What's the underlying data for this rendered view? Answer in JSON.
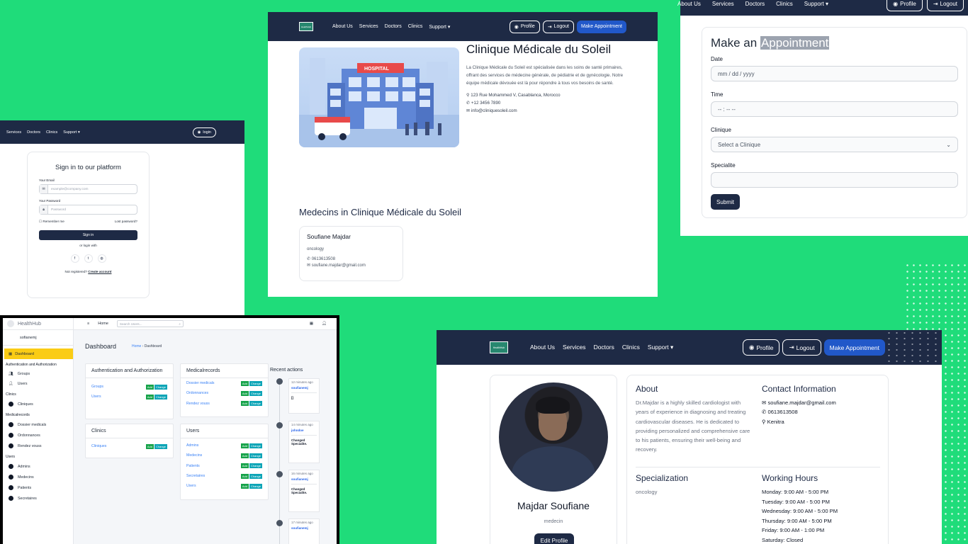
{
  "clinic_page": {
    "nav": {
      "logo": "HealthHub",
      "links": [
        "About Us",
        "Services",
        "Doctors",
        "Clinics",
        "Support ▾"
      ],
      "profile": "Profile",
      "logout": "Logout",
      "appointment": "Make Appointment"
    },
    "hospital_sign": "HOSPITAL",
    "title": "Clinique Médicale du Soleil",
    "description": "La Clinique Médicale du Soleil est spécialisée dans les soins de santé primaires, offrant des services de médecine générale, de pédiatrie et de gynécologie. Notre équipe médicale dévouée est là pour répondre à tous vos besoins de santé.",
    "address": "123 Rue Mohammed V, Casablanca, Morocco",
    "phone": "+12 3456 7890",
    "email": "info@cliniquesoleil.com",
    "medecins_title": "Medecins in Clinique Médicale du Soleil",
    "medecin": {
      "name": "Soufiane Majdar",
      "specialty": "oncology",
      "phone": "0613613508",
      "email": "soufiane.majdar@gmail.com"
    }
  },
  "appointment": {
    "nav": {
      "links": [
        "About Us",
        "Services",
        "Doctors",
        "Clinics",
        "Support ▾"
      ],
      "profile": "Profile",
      "logout": "Logout"
    },
    "title_a": "Make an ",
    "title_b": "Appointment",
    "date_label": "Date",
    "date_placeholder": "mm / dd / yyyy",
    "time_label": "Time",
    "time_placeholder": "-- : --  --",
    "clinique_label": "Clinique",
    "clinique_value": "Select a Clinique",
    "specialite_label": "Specialite",
    "specialite_value": "",
    "submit": "Submit"
  },
  "signin": {
    "nav": {
      "links": [
        "Services",
        "Doctors",
        "Clinics",
        "Support ▾"
      ],
      "login": "login"
    },
    "title": "Sign in to our platform",
    "email_label": "Your Email",
    "email_placeholder": "example@company.com",
    "password_label": "Your Password",
    "password_placeholder": "Password",
    "remember": "Remember me",
    "lost": "Lost password?",
    "button": "Sign in",
    "or": "or login with",
    "not_registered": "Not registered?",
    "create": "Create account"
  },
  "admin": {
    "brand": "HealthHub",
    "user": "sofianemj",
    "dashboard": "Dashboard",
    "sidebar": {
      "sec1": "Authentication and Authorization",
      "groups": "Groups",
      "users": "Users",
      "sec2": "Clinics",
      "cliniques": "Cliniques",
      "sec3": "Medicalrecords",
      "dossier": "Dossier medicals",
      "ordonnances": "Ordonnances",
      "rendez": "Rendez vouss",
      "sec4": "Users",
      "admins": "Admins",
      "medecins": "Medecins",
      "patients": "Patients",
      "secretaires": "Secretaires"
    },
    "top": {
      "home": "Home",
      "search": "Search Users..."
    },
    "page_title": "Dashboard",
    "crumb_home": "Home",
    "crumb_current": "Dashboard",
    "add": "Add",
    "change": "Change",
    "auth_box": {
      "title": "Authentication and Authorization",
      "rows": [
        "Groups",
        "Users"
      ]
    },
    "clinics_box": {
      "title": "Clinics",
      "rows": [
        "Cliniques"
      ]
    },
    "medical_box": {
      "title": "Medicalrecords",
      "rows": [
        "Dossier medicals",
        "Ordonnances",
        "Rendez vouss"
      ]
    },
    "users_box": {
      "title": "Users",
      "rows": [
        "Admins",
        "Medecins",
        "Patients",
        "Secretaires",
        "Users"
      ]
    },
    "recent_title": "Recent actions",
    "recent": [
      {
        "time": "12 minutes ago",
        "user": "soufianemj",
        "detail": "[]"
      },
      {
        "time": "14 minutes ago",
        "user": "johndoe",
        "detail": "Changed Specialite."
      },
      {
        "time": "16 minutes ago",
        "user": "soufianemj",
        "detail": "Changed Specialite."
      },
      {
        "time": "17 minutes ago",
        "user": "soufianemj",
        "detail": ""
      }
    ]
  },
  "profile": {
    "nav": {
      "logo": "HealthHub",
      "links": [
        "About Us",
        "Services",
        "Doctors",
        "Clinics",
        "Support ▾"
      ],
      "profile": "Profile",
      "logout": "Logout",
      "appointment": "Make Appointment"
    },
    "name": "Majdar Soufiane",
    "role": "medecin",
    "edit": "Edit Profile",
    "about_title": "About",
    "about": "Dr.Majdar is a highly skilled cardiologist with years of experience in diagnosing and treating cardiovascular diseases. He is dedicated to providing personalized and comprehensive care to his patients, ensuring their well-being and recovery.",
    "contact_title": "Contact Information",
    "email": "soufiane.majdar@gmail.com",
    "phone": "0613613508",
    "city": "Kenitra",
    "spec_title": "Specialization",
    "spec": "oncology",
    "hours_title": "Working Hours",
    "hours": [
      "Monday: 9:00 AM - 5:00 PM",
      "Tuesday: 9:00 AM - 5:00 PM",
      "Wednesday: 9:00 AM - 5:00 PM",
      "Thursday: 9:00 AM - 5:00 PM",
      "Friday: 9:00 AM - 1:00 PM",
      "Saturday: Closed"
    ]
  }
}
